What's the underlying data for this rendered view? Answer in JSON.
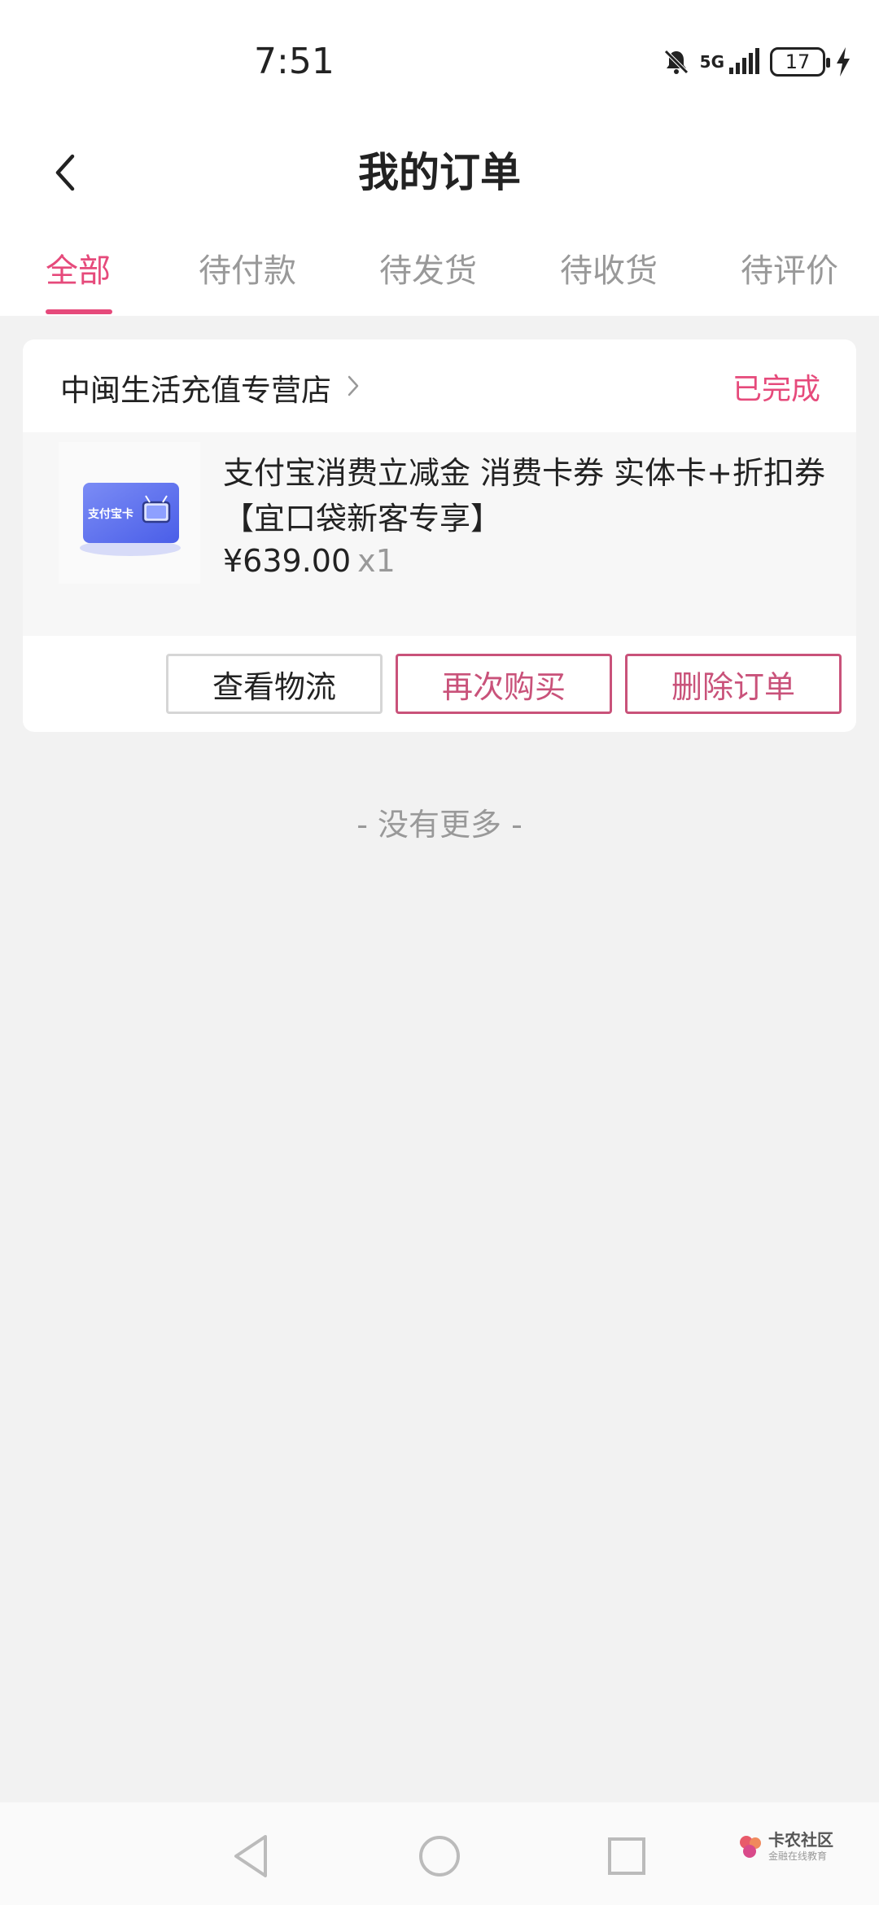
{
  "status_bar": {
    "time": "7:51",
    "network": "5G",
    "battery": "17"
  },
  "header": {
    "title": "我的订单"
  },
  "tabs": [
    {
      "label": "全部",
      "active": true
    },
    {
      "label": "待付款",
      "active": false
    },
    {
      "label": "待发货",
      "active": false
    },
    {
      "label": "待收货",
      "active": false
    },
    {
      "label": "待评价",
      "active": false
    }
  ],
  "order": {
    "store_name": "中闽生活充值专营店",
    "status": "已完成",
    "product": {
      "thumb_text": "支付宝卡",
      "title": "支付宝消费立减金 消费卡券 实体卡+折扣券【宜口袋新客专享】",
      "price": "¥639.00",
      "quantity": "x1"
    },
    "actions": {
      "logistics": "查看物流",
      "rebuy": "再次购买",
      "delete": "删除订单"
    }
  },
  "footer_text": "- 没有更多 -",
  "watermark": {
    "main": "卡农社区",
    "sub": "金融在线教育"
  },
  "colors": {
    "accent": "#e64a7b",
    "button_accent": "#c9527a",
    "background": "#f2f2f2"
  }
}
